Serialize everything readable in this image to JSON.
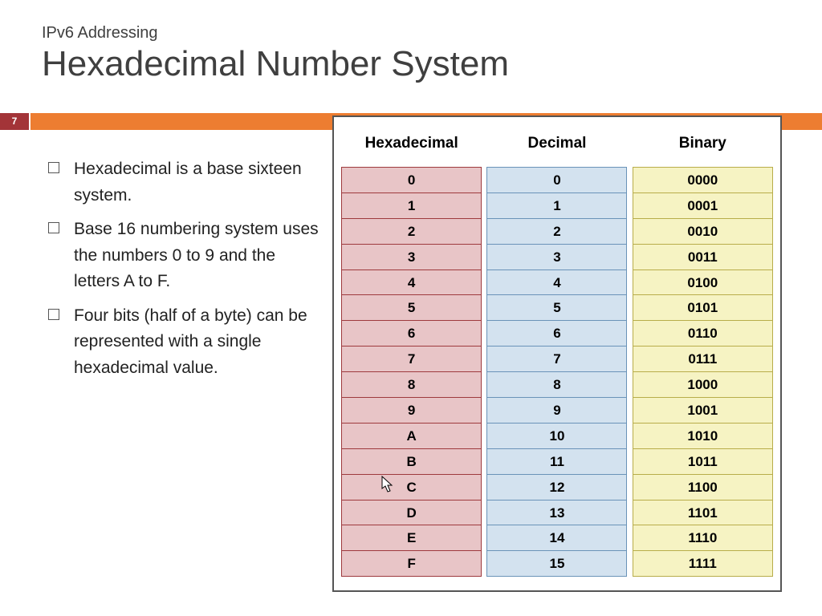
{
  "header": {
    "subtitle": "IPv6 Addressing",
    "title": "Hexadecimal Number System",
    "page_number": "7"
  },
  "bullets": [
    "Hexadecimal is a base sixteen system.",
    "Base 16 numbering system uses the numbers 0 to 9 and the letters A to F.",
    "Four bits (half of a byte) can be represented with a single hexadecimal value."
  ],
  "columns": {
    "hex": {
      "label": "Hexadecimal"
    },
    "dec": {
      "label": "Decimal"
    },
    "bin": {
      "label": "Binary"
    }
  },
  "chart_data": {
    "type": "table",
    "title": "Hexadecimal / Decimal / Binary equivalence",
    "columns": [
      "Hexadecimal",
      "Decimal",
      "Binary"
    ],
    "rows": [
      {
        "hex": "0",
        "dec": "0",
        "bin": "0000"
      },
      {
        "hex": "1",
        "dec": "1",
        "bin": "0001"
      },
      {
        "hex": "2",
        "dec": "2",
        "bin": "0010"
      },
      {
        "hex": "3",
        "dec": "3",
        "bin": "0011"
      },
      {
        "hex": "4",
        "dec": "4",
        "bin": "0100"
      },
      {
        "hex": "5",
        "dec": "5",
        "bin": "0101"
      },
      {
        "hex": "6",
        "dec": "6",
        "bin": "0110"
      },
      {
        "hex": "7",
        "dec": "7",
        "bin": "0111"
      },
      {
        "hex": "8",
        "dec": "8",
        "bin": "1000"
      },
      {
        "hex": "9",
        "dec": "9",
        "bin": "1001"
      },
      {
        "hex": "A",
        "dec": "10",
        "bin": "1010"
      },
      {
        "hex": "B",
        "dec": "11",
        "bin": "1011"
      },
      {
        "hex": "C",
        "dec": "12",
        "bin": "1100"
      },
      {
        "hex": "D",
        "dec": "13",
        "bin": "1101"
      },
      {
        "hex": "E",
        "dec": "14",
        "bin": "1110"
      },
      {
        "hex": "F",
        "dec": "15",
        "bin": "1111"
      }
    ]
  }
}
